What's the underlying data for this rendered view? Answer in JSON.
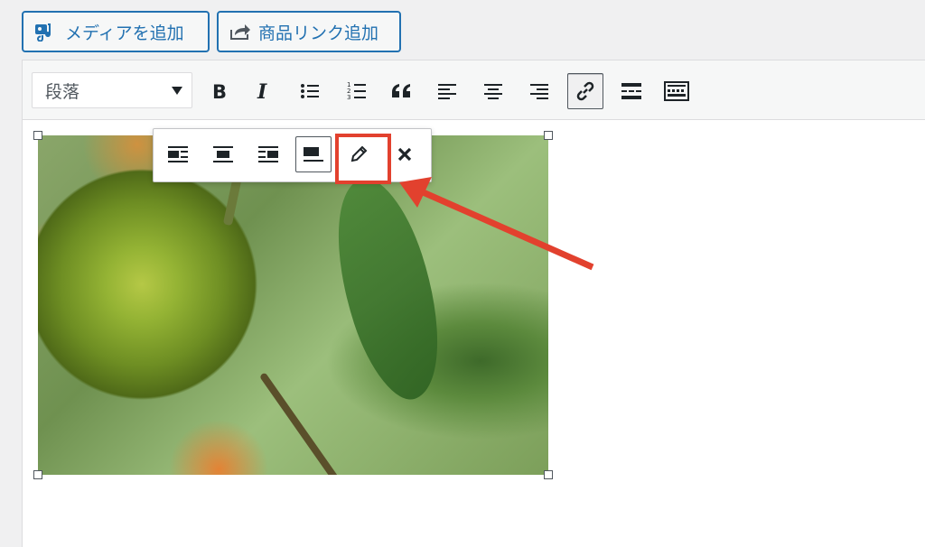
{
  "buttons": {
    "add_media": "メディアを追加",
    "add_product_link": "商品リンク追加"
  },
  "toolbar": {
    "format_select": "段落",
    "items": [
      "bold-icon",
      "italic-icon",
      "bullet-list-icon",
      "numbered-list-icon",
      "blockquote-icon",
      "align-left-icon",
      "align-center-icon",
      "align-right-icon",
      "link-icon",
      "read-more-icon",
      "toolbar-toggle-icon"
    ],
    "active": "link-icon"
  },
  "image_toolbar": {
    "items": [
      "align-left-icon",
      "align-center-icon",
      "align-right-icon",
      "align-none-icon",
      "edit-pencil-icon",
      "remove-icon"
    ],
    "active": "align-none-icon"
  },
  "colors": {
    "accent": "#2271b1",
    "annotation": "#e2412e"
  }
}
